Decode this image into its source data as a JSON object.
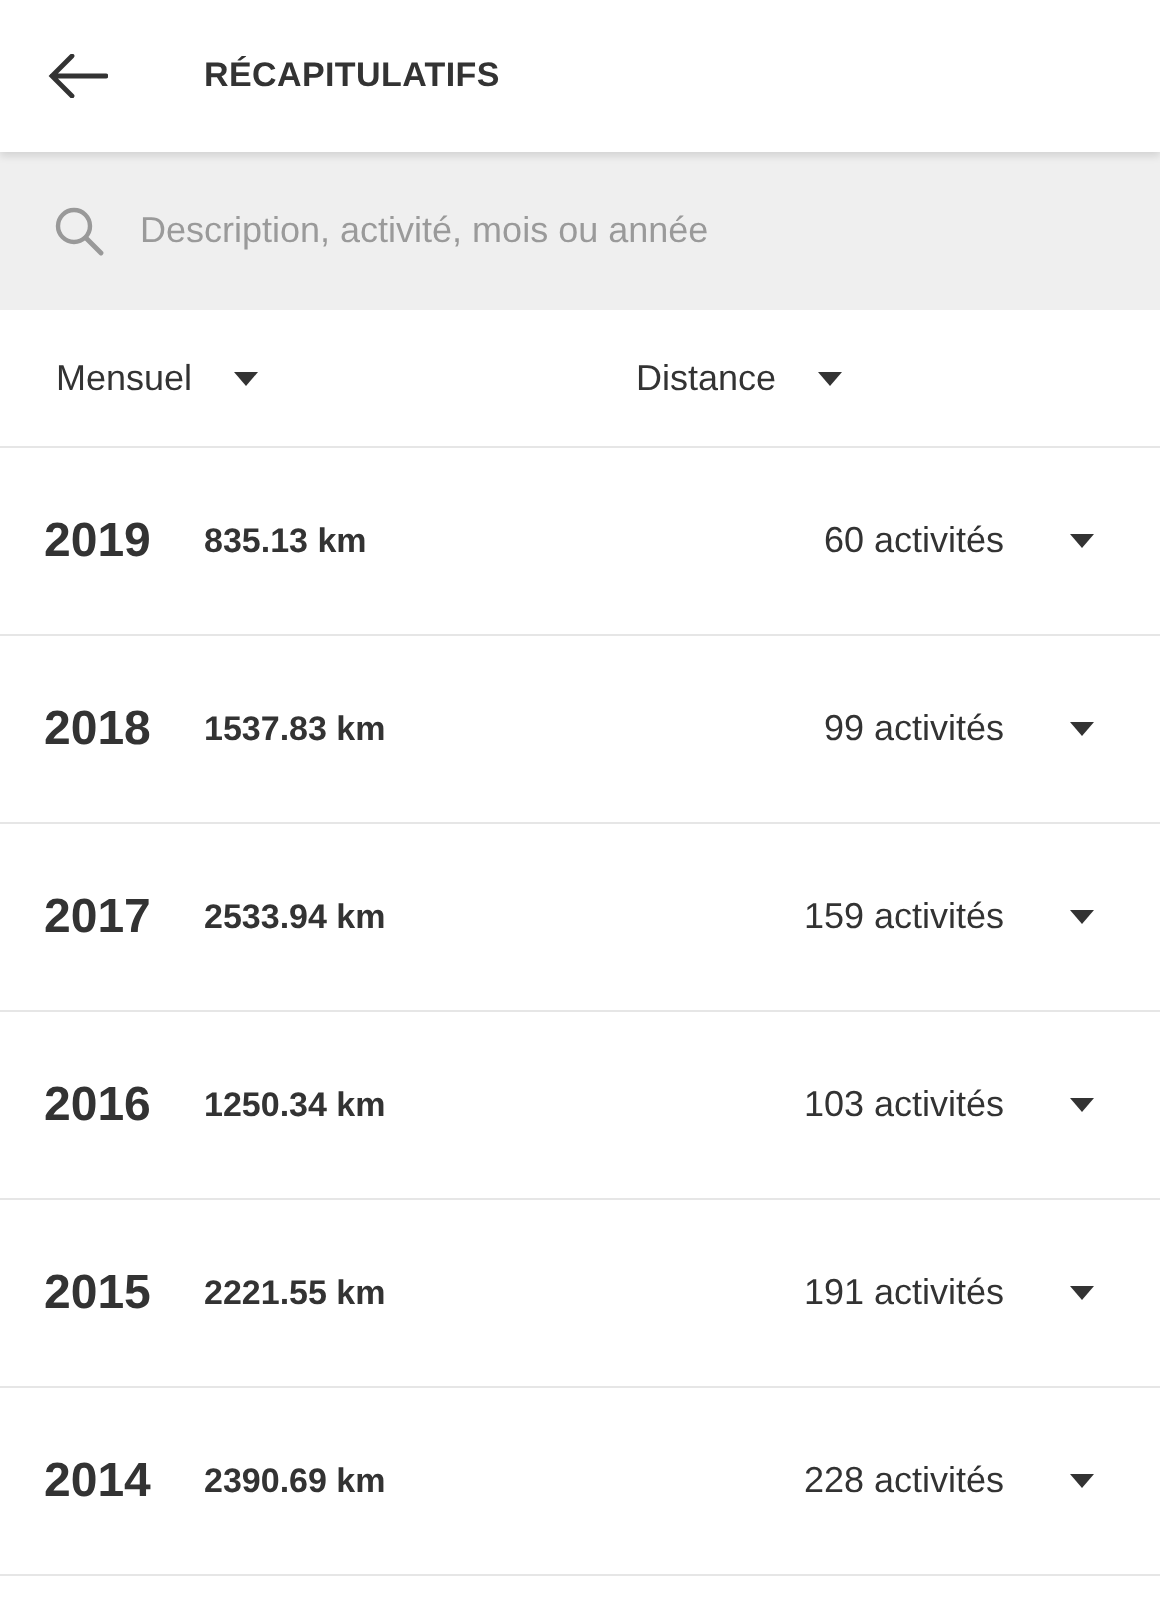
{
  "header": {
    "title": "RÉCAPITULATIFS"
  },
  "search": {
    "placeholder": "Description, activité, mois ou année"
  },
  "filters": [
    {
      "label": "Mensuel"
    },
    {
      "label": "Distance"
    }
  ],
  "summaries": [
    {
      "year": "2019",
      "distance": "835.13 km",
      "activities": "60 activités",
      "expanded": false
    },
    {
      "year": "2018",
      "distance": "1537.83 km",
      "activities": "99 activités",
      "expanded": false
    },
    {
      "year": "2017",
      "distance": "2533.94 km",
      "activities": "159 activités",
      "expanded": false
    },
    {
      "year": "2016",
      "distance": "1250.34 km",
      "activities": "103 activités",
      "expanded": false
    },
    {
      "year": "2015",
      "distance": "2221.55 km",
      "activities": "191 activités",
      "expanded": false
    },
    {
      "year": "2014",
      "distance": "2390.69 km",
      "activities": "228 activités",
      "expanded": false
    }
  ]
}
